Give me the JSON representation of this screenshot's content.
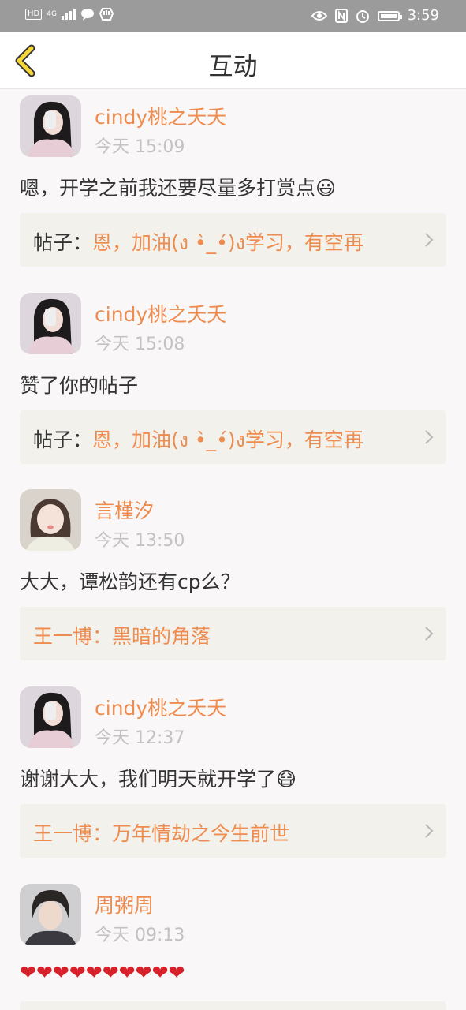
{
  "status_bar": {
    "left_badges": [
      "HD",
      "4G"
    ],
    "time": "3:59"
  },
  "header": {
    "title": "互动"
  },
  "feed": [
    {
      "username": "cindy桃之夭夭",
      "time": "今天 15:09",
      "content": "嗯，开学之前我还要尽量多打赏点😃",
      "post_prefix": "帖子：",
      "post_title": "恩，加油(ง •̀_•́)ง学习，有空再",
      "avatar": "girl-dark-hair-icon"
    },
    {
      "username": "cindy桃之夭夭",
      "time": "今天 15:08",
      "content": "赞了你的帖子",
      "post_prefix": "帖子：",
      "post_title": "恩，加油(ง •̀_•́)ง学习，有空再",
      "avatar": "girl-dark-hair-icon"
    },
    {
      "username": "言槿汐",
      "time": "今天 13:50",
      "content": "大大，谭松韵还有cp么？",
      "post_prefix": "王一博：",
      "post_title": "黑暗的角落",
      "avatar": "girl-child-icon"
    },
    {
      "username": "cindy桃之夭夭",
      "time": "今天 12:37",
      "content": "谢谢大大，我们明天就开学了😷",
      "post_prefix": "王一博：",
      "post_title": "万年情劫之今生前世",
      "avatar": "girl-dark-hair-icon"
    },
    {
      "username": "周粥周",
      "time": "今天 09:13",
      "content": "❤❤❤❤❤❤❤❤❤❤",
      "avatar": "boy-icon"
    }
  ],
  "colors": {
    "accent": "#ee8c4f",
    "back_icon": "#f4d53a",
    "status_bar": "#9b9b9b"
  }
}
